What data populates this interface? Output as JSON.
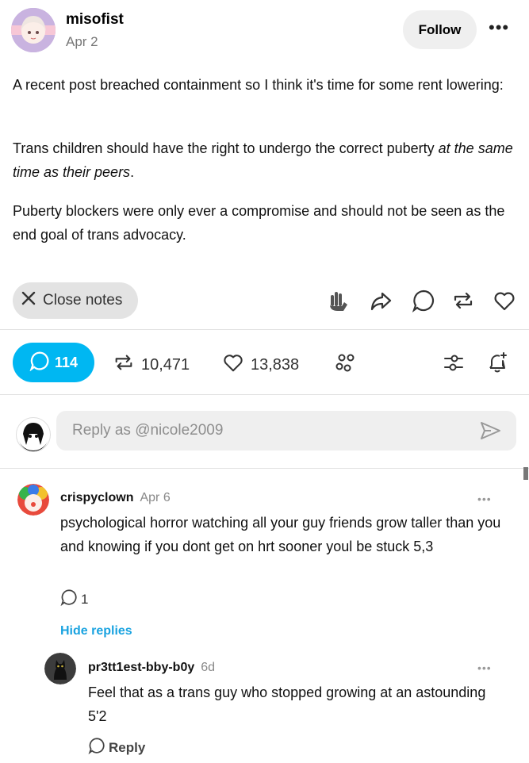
{
  "post": {
    "author": "misofist",
    "date": "Apr 2",
    "follow_label": "Follow",
    "more_label": "•••",
    "paragraphs": {
      "p1": "A recent post breached containment so I think it's time for some rent lowering:",
      "p2_plain": "Trans children should have the right to undergo the correct puberty ",
      "p2_italic": "at the same time as their peers",
      "p2_end": ".",
      "p3": "Puberty blockers were only ever a compromise and should not be seen as the end goal of trans advocacy."
    }
  },
  "actions": {
    "close_notes_label": "Close notes",
    "icons": [
      "wave-hand-icon",
      "share-icon",
      "comment-icon",
      "reblog-icon",
      "heart-icon"
    ]
  },
  "stats": {
    "replies": "114",
    "reblogs": "10,471",
    "likes": "13,838"
  },
  "reply_box": {
    "placeholder": "Reply as @nicole2009"
  },
  "comments": [
    {
      "author": "crispyclown",
      "date": "Apr 6",
      "text": "psychological horror watching all your guy friends grow taller than you and knowing if you dont get on hrt sooner youl be stuck 5,3",
      "reply_count": "1",
      "hide_replies_label": "Hide replies",
      "more_label": "•••"
    },
    {
      "author": "pr3tt1est-bby-b0y",
      "date": "6d",
      "text": "Feel that as a trans guy who stopped growing at an astounding 5'2",
      "reply_label": "Reply",
      "more_label": "•••"
    }
  ],
  "colors": {
    "accent_blue": "#00b7f2",
    "link_blue": "#1aa3e0",
    "pill_gray": "#e3e3e3",
    "input_gray": "#efefef"
  }
}
